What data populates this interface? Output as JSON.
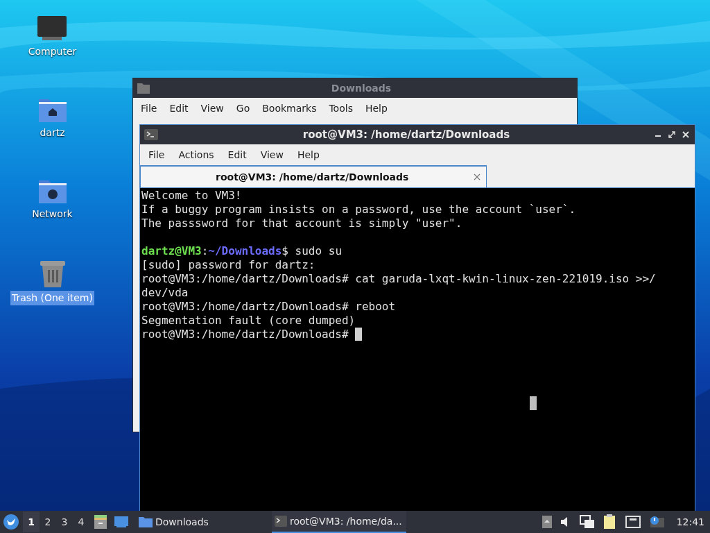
{
  "desktop_icons": [
    {
      "label": "Computer",
      "kind": "computer",
      "selected": false
    },
    {
      "label": "dartz",
      "kind": "home",
      "selected": false
    },
    {
      "label": "Network",
      "kind": "network",
      "selected": false
    },
    {
      "label": "Trash (One item)",
      "kind": "trash",
      "selected": true
    }
  ],
  "file_manager": {
    "title": "Downloads",
    "menu": [
      "File",
      "Edit",
      "View",
      "Go",
      "Bookmarks",
      "Tools",
      "Help"
    ]
  },
  "terminal": {
    "title": "root@VM3: /home/dartz/Downloads",
    "menu": [
      "File",
      "Actions",
      "Edit",
      "View",
      "Help"
    ],
    "tabs": [
      {
        "label": "root@VM3: /home/dartz/Downloads",
        "selected": true
      }
    ],
    "lines": [
      [
        {
          "kind": "plain",
          "text": "Welcome to VM3!"
        }
      ],
      [
        {
          "kind": "plain",
          "text": "If a buggy program insists on a password, use the account `user`."
        }
      ],
      [
        {
          "kind": "plain",
          "text": "The passsword for that account is simply \"user\"."
        }
      ],
      [
        {
          "kind": "blank"
        }
      ],
      [
        {
          "kind": "user",
          "text": "dartz@VM3"
        },
        {
          "kind": "plain",
          "text": ":"
        },
        {
          "kind": "path",
          "text": "~/Downloads"
        },
        {
          "kind": "plain",
          "text": "$ sudo su"
        }
      ],
      [
        {
          "kind": "plain",
          "text": "[sudo] password for dartz:"
        }
      ],
      [
        {
          "kind": "plain",
          "text": "root@VM3:/home/dartz/Downloads# cat garuda-lxqt-kwin-linux-zen-221019.iso >>/"
        }
      ],
      [
        {
          "kind": "plain",
          "text": "dev/vda"
        }
      ],
      [
        {
          "kind": "plain",
          "text": "root@VM3:/home/dartz/Downloads# reboot"
        }
      ],
      [
        {
          "kind": "plain",
          "text": "Segmentation fault (core dumped)"
        }
      ],
      [
        {
          "kind": "plain",
          "text": "root@VM3:/home/dartz/Downloads# "
        },
        {
          "kind": "cursor"
        }
      ]
    ]
  },
  "taskbar": {
    "workspaces": [
      {
        "label": "1",
        "selected": true
      },
      {
        "label": "2",
        "selected": false
      },
      {
        "label": "3",
        "selected": false
      },
      {
        "label": "4",
        "selected": false
      }
    ],
    "tasks": [
      {
        "label": "Downloads",
        "kind": "folder",
        "selected": false
      },
      {
        "label": "root@VM3: /home/da...",
        "kind": "terminal",
        "selected": true
      }
    ],
    "clock": "12:41"
  }
}
